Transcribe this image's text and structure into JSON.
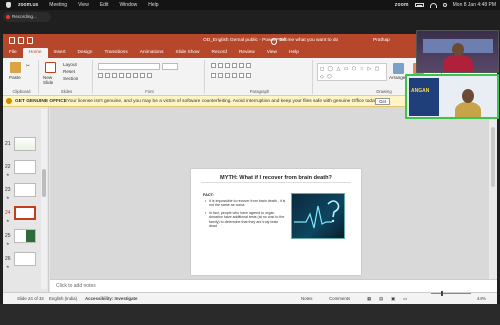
{
  "mac_menu": {
    "app_name": "zoom.us",
    "items": [
      "Meeting",
      "View",
      "Edit",
      "Window",
      "Help"
    ],
    "brand": "zoom",
    "datetime": "Mon 8 Jan  4:48 PM"
  },
  "recording": {
    "label": "Recording..."
  },
  "powerpoint": {
    "window_title": "OD_English Gemal public  -  PowerPoint",
    "tell_me": "Tell me what you want to do",
    "user": "Prathap",
    "tabs": [
      "File",
      "Home",
      "Insert",
      "Design",
      "Transitions",
      "Animations",
      "Slide Show",
      "Record",
      "Review",
      "View",
      "Help"
    ],
    "active_tab": "Home",
    "ribbon": {
      "paste": "Paste",
      "clipboard": "Clipboard",
      "new_slide": "New Slide",
      "layout": "Layout",
      "reset": "Reset",
      "section": "Section",
      "slides": "Slides",
      "font": "Font",
      "paragraph": "Paragraph",
      "arrange": "Arrange",
      "quick_styles": "Quick Styles",
      "shape_fill": "Shape Fill",
      "shape_outline": "Shape Outline",
      "shape_effects": "Shape Effects",
      "drawing": "Drawing"
    },
    "notice": {
      "heading": "GET GENUINE OFFICE",
      "message": "Your license isn't genuine, and you may be a victim of software counterfeiting. Avoid interruption and keep your files safe with genuine Office today.",
      "button": "Get"
    },
    "thumbnails": [
      {
        "num": "21",
        "selected": false
      },
      {
        "num": "22",
        "selected": false
      },
      {
        "num": "23",
        "selected": false
      },
      {
        "num": "24",
        "selected": true
      },
      {
        "num": "25",
        "selected": false
      },
      {
        "num": "26",
        "selected": false
      }
    ],
    "slide": {
      "title": "MYTH: What if I recover from brain death?",
      "fact_label": "FACT:",
      "bullets": [
        "It is impossible to recover from brain death - it is not the same as coma",
        "In fact, people who have agreed to organ donation have additional tests (at no cost to the family) to determine that they are truly brain dead"
      ]
    },
    "notes_placeholder": "Click to add notes",
    "status": {
      "slide_counter": "Slide 24 of 32",
      "language": "English (India)",
      "accessibility": "Accessibility: Investigate",
      "notes": "Notes",
      "comments": "Comments",
      "zoom": "44%"
    }
  },
  "participants": {
    "tile2_banner": "ANGAN"
  }
}
